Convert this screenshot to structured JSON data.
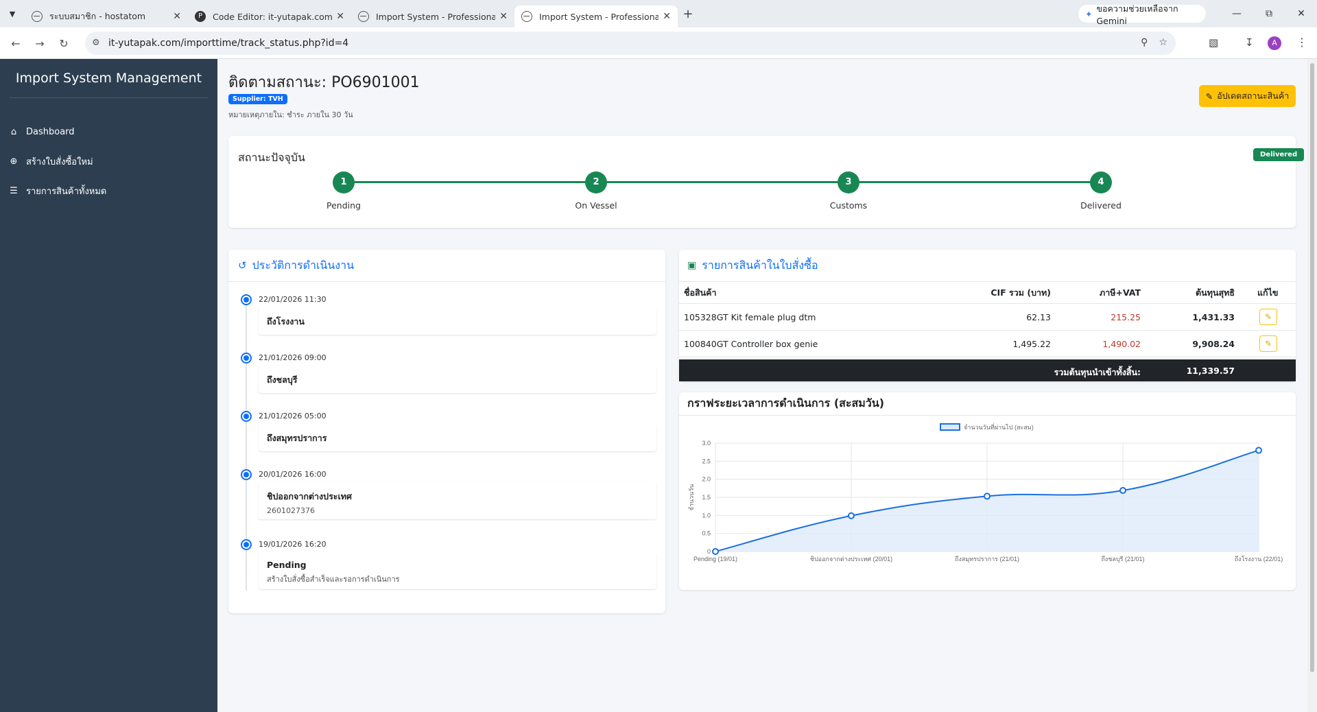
{
  "browser": {
    "tabs": [
      {
        "label": "ระบบสมาชิก - hostatom",
        "active": false
      },
      {
        "label": "Code Editor: it-yutapak.com / h",
        "active": false
      },
      {
        "label": "Import System - Professional",
        "active": false
      },
      {
        "label": "Import System - Professional",
        "active": true
      }
    ],
    "gemini_label": "ขอความช่วยเหลือจาก Gemini",
    "url": "it-yutapak.com/importtime/track_status.php?id=4",
    "avatar_letter": "A"
  },
  "sidebar": {
    "brand": "Import System Management",
    "items": [
      {
        "label": "Dashboard",
        "icon": "home-icon"
      },
      {
        "label": "สร้างใบสั่งซื้อใหม่",
        "icon": "plus-circle-icon"
      },
      {
        "label": "รายการสินค้าทั้งหมด",
        "icon": "list-icon"
      }
    ]
  },
  "page": {
    "title": "ติดตามสถานะ: PO6901001",
    "supplier_badge": "Supplier: TVH",
    "note": "หมายเหตุภายใน: ชำระ ภายใน 30 วัน",
    "update_button": "อัปเดตสถานะสินค้า"
  },
  "status": {
    "title": "สถานะปัจจุบัน",
    "badge": "Delivered",
    "badge_color": "#198754",
    "steps": [
      {
        "num": "1",
        "label": "Pending"
      },
      {
        "num": "2",
        "label": "On Vessel"
      },
      {
        "num": "3",
        "label": "Customs"
      },
      {
        "num": "4",
        "label": "Delivered"
      }
    ]
  },
  "history": {
    "title": "ประวัติการดำเนินงาน",
    "items": [
      {
        "date": "22/01/2026 11:30",
        "title": "ถึงโรงงาน",
        "detail": ""
      },
      {
        "date": "21/01/2026 09:00",
        "title": "ถึงชลบุรี",
        "detail": ""
      },
      {
        "date": "21/01/2026 05:00",
        "title": "ถึงสมุทรปราการ",
        "detail": ""
      },
      {
        "date": "20/01/2026 16:00",
        "title": "ชิปออกจากต่างประเทศ",
        "detail": "2601027376"
      },
      {
        "date": "19/01/2026 16:20",
        "title": "Pending",
        "detail": "สร้างใบสั่งซื้อสำเร็จและรอการดำเนินการ"
      }
    ]
  },
  "items": {
    "title": "รายการสินค้าในใบสั่งซื้อ",
    "headers": {
      "name": "ชื่อสินค้า",
      "cif": "CIF รวม (บาท)",
      "tax": "ภาษี+VAT",
      "net": "ต้นทุนสุทธิ",
      "edit": "แก้ไข"
    },
    "rows": [
      {
        "name": "105328GT Kit female plug dtm",
        "cif": "62.13",
        "tax": "215.25",
        "net": "1,431.33"
      },
      {
        "name": "100840GT Controller box genie",
        "cif": "1,495.22",
        "tax": "1,490.02",
        "net": "9,908.24"
      }
    ],
    "total_label": "รวมต้นทุนนำเข้าทั้งสิ้น:",
    "total_value": "11,339.57"
  },
  "chart_title": "กราฟระยะเวลาการดำเนินการ (สะสมวัน)",
  "chart_data": {
    "type": "line",
    "legend": "จำนวนวันที่ผ่านไป (สะสม)",
    "legend_position": "top",
    "ylabel": "จำนวนวัน",
    "xlabel": "",
    "categories": [
      "Pending (19/01)",
      "ชิปออกจากต่างประเทศ (20/01)",
      "ถึงสมุทรปราการ (21/01)",
      "ถึงชลบุรี (21/01)",
      "ถึงโรงงาน (22/01)"
    ],
    "values": [
      0,
      0.99,
      1.53,
      1.69,
      2.8
    ],
    "ylim": [
      0,
      3
    ],
    "yticks": [
      "0",
      "0.5",
      "1.0",
      "1.5",
      "2.0",
      "2.5",
      "3.0"
    ],
    "grid": true,
    "fill": true,
    "line_color": "#1a6fdf",
    "fill_color": "#dce9fb"
  }
}
